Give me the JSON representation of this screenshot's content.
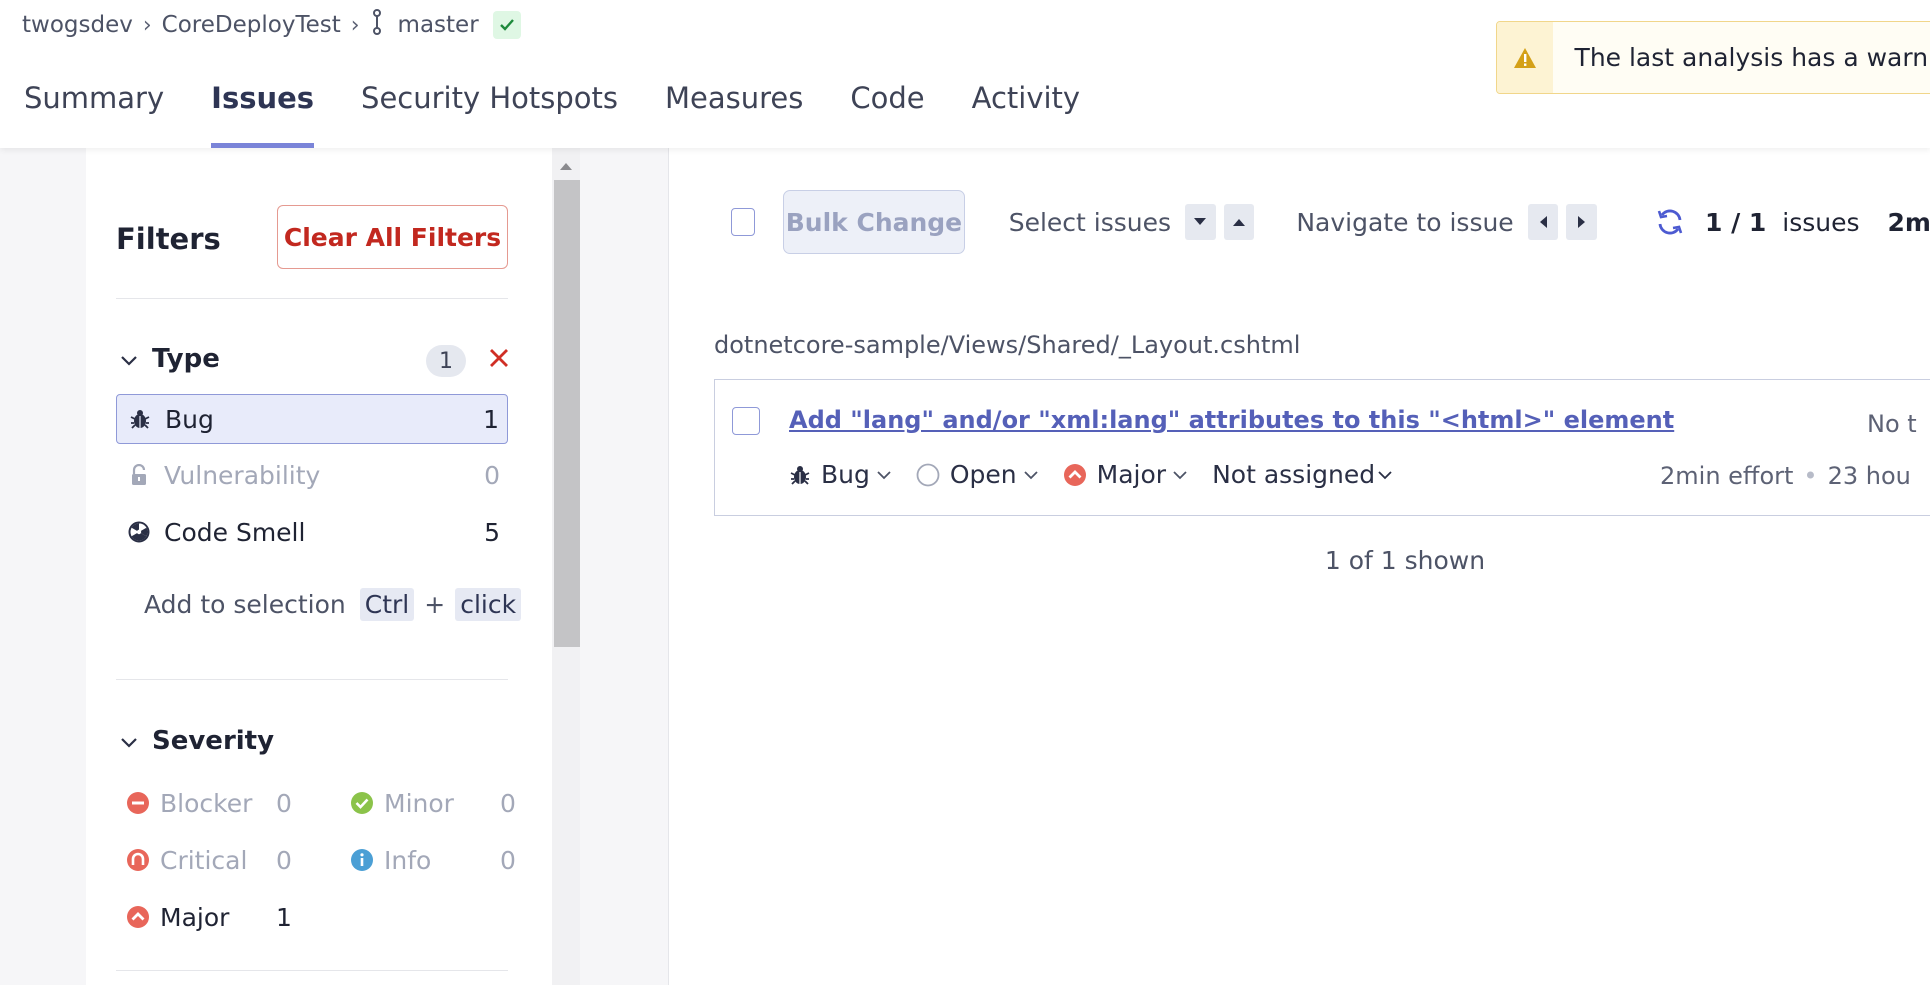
{
  "breadcrumb": {
    "org": "twogsdev",
    "project": "CoreDeployTest",
    "branch": "master"
  },
  "tabs": [
    {
      "label": "Summary",
      "active": false
    },
    {
      "label": "Issues",
      "active": true
    },
    {
      "label": "Security Hotspots",
      "active": false
    },
    {
      "label": "Measures",
      "active": false
    },
    {
      "label": "Code",
      "active": false
    },
    {
      "label": "Activity",
      "active": false
    }
  ],
  "warning": {
    "text": "The last analysis has a warni"
  },
  "filters": {
    "title": "Filters",
    "clear_label": "Clear All Filters",
    "type": {
      "title": "Type",
      "selected_count": "1",
      "items": [
        {
          "label": "Bug",
          "count": "1",
          "icon": "bug-icon",
          "selected": true
        },
        {
          "label": "Vulnerability",
          "count": "0",
          "icon": "lock-icon",
          "selected": false
        },
        {
          "label": "Code Smell",
          "count": "5",
          "icon": "code-smell-icon",
          "selected": false
        }
      ],
      "hint": {
        "text": "Add to selection",
        "key1": "Ctrl",
        "plus": "+",
        "key2": "click"
      }
    },
    "severity": {
      "title": "Severity",
      "items": [
        {
          "label": "Blocker",
          "count": "0",
          "icon": "blocker-icon"
        },
        {
          "label": "Minor",
          "count": "0",
          "icon": "minor-icon"
        },
        {
          "label": "Critical",
          "count": "0",
          "icon": "critical-icon"
        },
        {
          "label": "Info",
          "count": "0",
          "icon": "info-icon"
        },
        {
          "label": "Major",
          "count": "1",
          "icon": "major-icon"
        }
      ]
    }
  },
  "toolbar": {
    "bulk_change": "Bulk Change",
    "select_issues": "Select issues",
    "navigate": "Navigate to issue",
    "count_bold": "1 / 1",
    "count_suffix": "issues",
    "effort": "2m"
  },
  "issues": {
    "file_path": "dotnetcore-sample/Views/Shared/_Layout.cshtml",
    "list": [
      {
        "title": "Add \"lang\" and/or \"xml:lang\" attributes to this \"<html>\" element",
        "type": "Bug",
        "status": "Open",
        "severity": "Major",
        "assignee": "Not assigned",
        "tags": "No t",
        "effort": "2min effort",
        "age": "23 hou"
      }
    ],
    "shown": "1 of 1 shown"
  },
  "colors": {
    "accent": "#5560b8",
    "danger": "#c2281f",
    "severity_red": "#e8665a",
    "severity_green": "#8bc34a",
    "info_blue": "#4b9fd5",
    "warning_amber": "#d4a017"
  }
}
